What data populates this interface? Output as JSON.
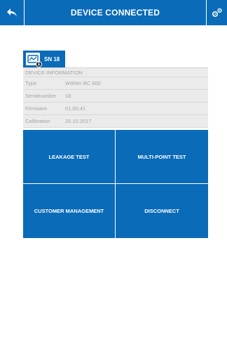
{
  "header": {
    "title": "DEVICE CONNECTED"
  },
  "device_tab": {
    "label": "SN 18",
    "icon_badge": "1"
  },
  "device_info": {
    "header": "DEVICE INFORMATION",
    "rows": [
      {
        "key": "Type",
        "value": "Wöhler BC 600"
      },
      {
        "key": "Serialnumber",
        "value": "18"
      },
      {
        "key": "Firmware",
        "value": "01.00.41"
      },
      {
        "key": "Calibration",
        "value": "26.10.2017"
      }
    ]
  },
  "actions": {
    "leakage_test": "LEAKAGE TEST",
    "multi_point_test": "MULTI-POINT TEST",
    "customer_management": "CUSTOMER MANAGEMENT",
    "disconnect": "DISCONNECT"
  },
  "colors": {
    "primary": "#0a6bb8",
    "info_bg": "#ebebeb",
    "info_text": "#a3a3a3"
  },
  "icons": {
    "back": "back-arrow-icon",
    "settings": "gears-icon",
    "device": "device-icon"
  }
}
